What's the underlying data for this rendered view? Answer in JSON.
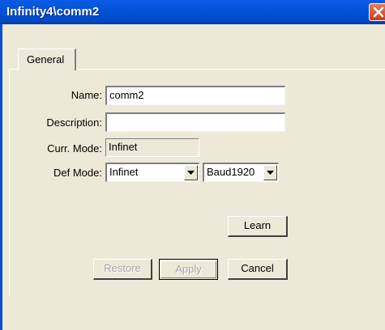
{
  "window": {
    "title": "Infinity4\\comm2",
    "close_icon": "close-icon"
  },
  "tabs": [
    {
      "label": "General",
      "selected": true
    }
  ],
  "form": {
    "name": {
      "label": "Name:",
      "value": "comm2"
    },
    "description": {
      "label": "Description:",
      "value": ""
    },
    "curr_mode": {
      "label": "Curr. Mode:",
      "value": "Infinet"
    },
    "def_mode": {
      "label": "Def Mode:",
      "value": "Infinet",
      "baud": "Baud1920"
    }
  },
  "buttons": {
    "learn": "Learn",
    "restore": "Restore",
    "apply": "Apply",
    "cancel": "Cancel"
  },
  "colors": {
    "titlebar": "#0053d8",
    "close_button": "#d0502a",
    "dialog_bg": "#ece9d8"
  }
}
